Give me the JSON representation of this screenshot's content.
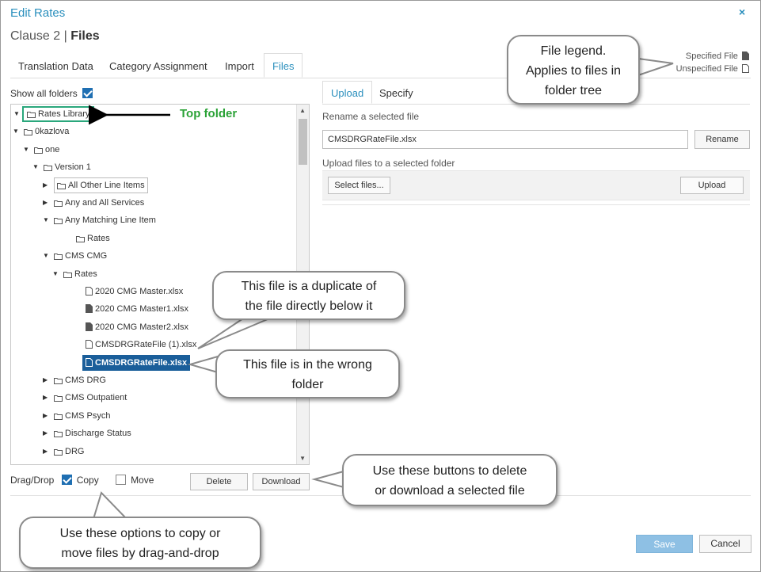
{
  "dialog": {
    "title": "Edit Rates",
    "close_glyph": "×",
    "subtitle_prefix": "Clause 2 | ",
    "subtitle_bold": "Files"
  },
  "tabs": [
    {
      "label": "Translation Data"
    },
    {
      "label": "Category Assignment"
    },
    {
      "label": "Import"
    },
    {
      "label": "Files",
      "active": true
    }
  ],
  "legend": {
    "specified": "Specified File",
    "unspecified": "Unspecified File"
  },
  "show_all": {
    "label": "Show all folders",
    "checked": true
  },
  "tree": [
    {
      "label": "Rates Library",
      "type": "folder",
      "arrow": "▼"
    },
    {
      "label": "0kazlova",
      "type": "folder",
      "arrow": "▼"
    },
    {
      "label": "one",
      "type": "folder",
      "arrow": "▼"
    },
    {
      "label": "Version 1",
      "type": "folder",
      "arrow": "▼"
    },
    {
      "label": "All Other Line Items",
      "type": "folder",
      "arrow": "▶"
    },
    {
      "label": "Any and All Services",
      "type": "folder",
      "arrow": "▶"
    },
    {
      "label": "Any Matching Line Item",
      "type": "folder",
      "arrow": "▼"
    },
    {
      "label": "Rates",
      "type": "folder",
      "arrow": ""
    },
    {
      "label": "CMS CMG",
      "type": "folder",
      "arrow": "▼"
    },
    {
      "label": "Rates",
      "type": "folder",
      "arrow": "▼"
    },
    {
      "label": "2020 CMG Master.xlsx",
      "type": "file-unspecified",
      "arrow": ""
    },
    {
      "label": "2020 CMG Master1.xlsx",
      "type": "file-specified",
      "arrow": ""
    },
    {
      "label": "2020 CMG Master2.xlsx",
      "type": "file-specified",
      "arrow": ""
    },
    {
      "label": "CMSDRGRateFile (1).xlsx",
      "type": "file-unspecified",
      "arrow": ""
    },
    {
      "label": "CMSDRGRateFile.xlsx",
      "type": "file-unspecified",
      "arrow": "",
      "selected": true
    },
    {
      "label": "CMS DRG",
      "type": "folder",
      "arrow": "▶"
    },
    {
      "label": "CMS Outpatient",
      "type": "folder",
      "arrow": "▶"
    },
    {
      "label": "CMS Psych",
      "type": "folder",
      "arrow": "▶"
    },
    {
      "label": "Discharge Status",
      "type": "folder",
      "arrow": "▶"
    },
    {
      "label": "DRG",
      "type": "folder",
      "arrow": "▶"
    }
  ],
  "drag_drop": {
    "label": "Drag/Drop",
    "copy": {
      "label": "Copy",
      "checked": true
    },
    "move": {
      "label": "Move",
      "checked": false
    },
    "delete_label": "Delete",
    "download_label": "Download"
  },
  "panel": {
    "tabs": [
      {
        "label": "Upload",
        "active": true
      },
      {
        "label": "Specify"
      }
    ],
    "rename_label": "Rename a selected file",
    "rename_value": "CMSDRGRateFile.xlsx",
    "rename_button": "Rename",
    "upload_label": "Upload files to a selected folder",
    "select_files_button": "Select files...",
    "upload_button": "Upload"
  },
  "footer": {
    "save_label": "Save",
    "cancel_label": "Cancel"
  },
  "annotations": {
    "top_folder": "Top folder",
    "legend_note": [
      "File legend.",
      "Applies to files in",
      "folder tree"
    ],
    "duplicate_note": [
      "This file is a duplicate of",
      "the file directly below it"
    ],
    "wrong_folder_note": [
      "This file is in the wrong",
      "folder"
    ],
    "buttons_note": [
      "Use these buttons to delete",
      "or download a selected file"
    ],
    "drag_note": [
      "Use these options to copy or",
      "move files by drag-and-drop"
    ]
  },
  "colors": {
    "accent": "#2a8fbd",
    "selected_bg": "#1a5e9a",
    "top_folder_green": "#2aa236",
    "save_button": "#8ec0e4"
  }
}
